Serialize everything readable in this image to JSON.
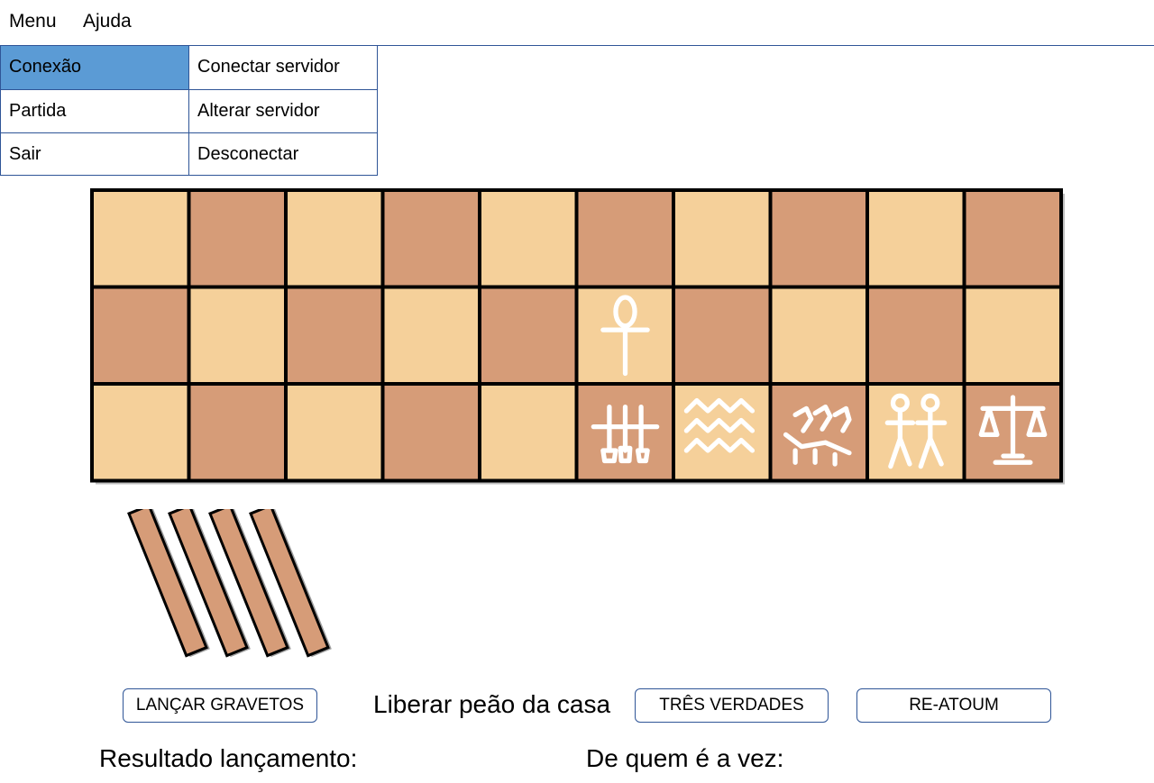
{
  "menubar": {
    "menu_label": "Menu",
    "help_label": "Ajuda"
  },
  "main_menu": {
    "items": [
      "Conexão",
      "Partida",
      "Sair"
    ],
    "active_index": 0
  },
  "submenu": {
    "items": [
      "Conectar servidor",
      "Alterar servidor",
      "Desconectar"
    ]
  },
  "board": {
    "rows": 3,
    "cols": 10,
    "colors": {
      "light": "#f5d09a",
      "dark": "#d69c78",
      "border": "#000000",
      "glyph": "#ffffff"
    },
    "special_squares": [
      {
        "row": 1,
        "col": 5,
        "icon": "ankh-icon"
      },
      {
        "row": 2,
        "col": 5,
        "icon": "three-hieroglyph-icon"
      },
      {
        "row": 2,
        "col": 6,
        "icon": "water-icon"
      },
      {
        "row": 2,
        "col": 7,
        "icon": "birds-icon"
      },
      {
        "row": 2,
        "col": 8,
        "icon": "two-figures-icon"
      },
      {
        "row": 2,
        "col": 9,
        "icon": "scales-icon"
      }
    ]
  },
  "sticks": {
    "count": 4,
    "color": "#d69c78",
    "icon": "throwing-stick-icon"
  },
  "actions": {
    "throw_sticks": "LANÇAR GRAVETOS",
    "release_pawn": "Liberar peão da casa",
    "three_truths": "TRÊS VERDADES",
    "re_atoum": "RE-ATOUM"
  },
  "status": {
    "result_label": "Resultado lançamento:",
    "turn_label": "De quem é a vez:"
  }
}
